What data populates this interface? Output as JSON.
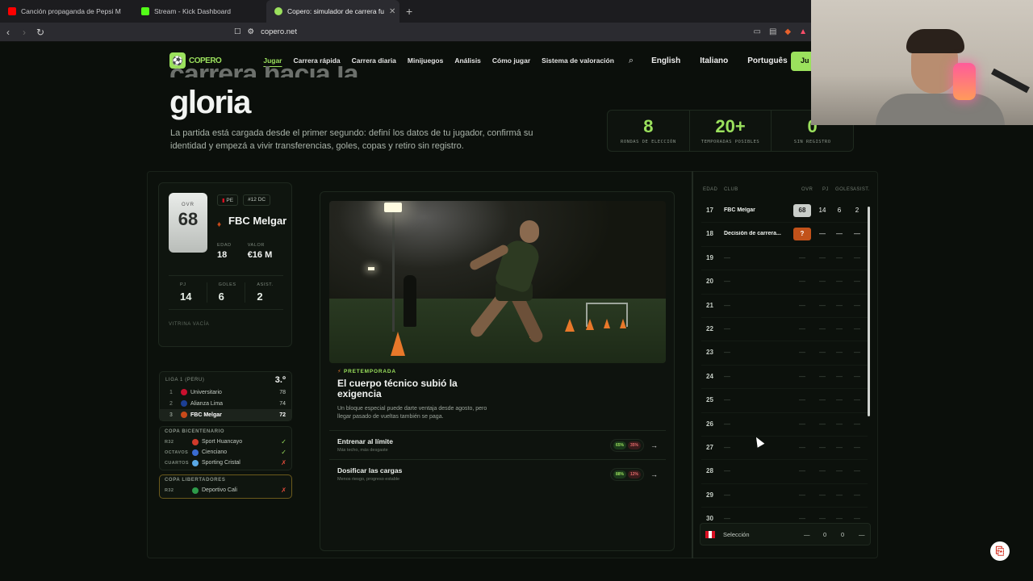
{
  "browser": {
    "tabs": [
      {
        "title": "Canción propaganda de Pepsi M",
        "color": "#ff0000"
      },
      {
        "title": "Stream - Kick Dashboard",
        "color": "#53fc18"
      },
      {
        "title": "Copero: simulador de carrera fu",
        "color": "#9be15d",
        "active": true
      }
    ],
    "url": "copero.net"
  },
  "header": {
    "logo_text": "COPERO",
    "menu": [
      "Jugar",
      "Carrera rápida",
      "Carrera diaria",
      "Minijuegos",
      "Análisis",
      "Cómo jugar",
      "Sistema de valoración"
    ],
    "langs": [
      "English",
      "Italiano",
      "Português"
    ],
    "cta": "Ju"
  },
  "hero": {
    "title_partial": "carrera hacia la",
    "title": "gloria",
    "subtitle": "La partida está cargada desde el primer segundo: definí los datos de tu jugador, confirmá su identidad y empezá a vivir transferencias, goles, copas y retiro sin registro.",
    "stats": [
      {
        "num": "8",
        "label": "RONDAS DE ELECCIÓN"
      },
      {
        "num": "20+",
        "label": "TEMPORADAS POSIBLES"
      },
      {
        "num": "0",
        "label": "SIN REGISTRO"
      }
    ]
  },
  "player": {
    "ovr_label": "OVR",
    "ovr": "68",
    "country": "PE",
    "number": "#12 DC",
    "club": "FBC Melgar",
    "age_label": "EDAD",
    "age": "18",
    "value_label": "VALOR",
    "value": "€16 M",
    "pj_label": "PJ",
    "pj": "14",
    "goals_label": "GOLES",
    "goals": "6",
    "assists_label": "ASIST.",
    "assists": "2",
    "trophies": "VITRINA VACÍA"
  },
  "league": {
    "name": "LIGA 1 (PERU)",
    "position": "3.º",
    "rows": [
      {
        "rank": "1",
        "team": "Universitario",
        "pts": "78",
        "color": "#c8102e"
      },
      {
        "rank": "2",
        "team": "Alianza Lima",
        "pts": "74",
        "color": "#1c3f94"
      },
      {
        "rank": "3",
        "team": "FBC Melgar",
        "pts": "72",
        "color": "#c84a1a",
        "highlight": true
      }
    ]
  },
  "cups": [
    {
      "title": "COPA BICENTENARIO",
      "rows": [
        {
          "round": "R32",
          "team": "Sport Huancayo",
          "result": "✓",
          "ok": true,
          "color": "#d13a2b"
        },
        {
          "round": "OCTAVOS",
          "team": "Cienciano",
          "result": "✓",
          "ok": true,
          "color": "#3a6bd1"
        },
        {
          "round": "CUARTOS",
          "team": "Sporting Cristal",
          "result": "✗",
          "ok": false,
          "color": "#5aa9e6"
        }
      ]
    },
    {
      "title": "COPA LIBERTADORES",
      "rows": [
        {
          "round": "R32",
          "team": "Deportivo Cali",
          "result": "✗",
          "ok": false,
          "color": "#2e9b4a"
        }
      ]
    }
  ],
  "event": {
    "tag": "PRETEMPORADA",
    "title": "El cuerpo técnico subió la exigencia",
    "desc": "Un bloque especial puede darte ventaja desde agosto, pero llegar pasado de vueltas también se paga.",
    "options": [
      {
        "title": "Entrenar al límite",
        "sub": "Más techo, más desgaste",
        "good": "65%",
        "bad": "35%"
      },
      {
        "title": "Dosificar las cargas",
        "sub": "Menos riesgo, progreso estable",
        "good": "88%",
        "bad": "12%"
      }
    ]
  },
  "career": {
    "headers": [
      "EDAD",
      "CLUB",
      "OVR",
      "PJ",
      "GOLES",
      "ASIST."
    ],
    "rows": [
      {
        "age": "17",
        "club": "FBC Melgar",
        "ovr": "68",
        "pj": "14",
        "goles": "6",
        "asist": "2",
        "kind": "silver"
      },
      {
        "age": "18",
        "club": "Decisión de carrera...",
        "ovr": "?",
        "pj": "—",
        "goles": "—",
        "asist": "—",
        "kind": "orange"
      },
      {
        "age": "19",
        "club": "—",
        "ovr": "—",
        "pj": "—",
        "goles": "—",
        "asist": "—"
      },
      {
        "age": "20",
        "club": "—",
        "ovr": "—",
        "pj": "—",
        "goles": "—",
        "asist": "—"
      },
      {
        "age": "21",
        "club": "—",
        "ovr": "—",
        "pj": "—",
        "goles": "—",
        "asist": "—"
      },
      {
        "age": "22",
        "club": "—",
        "ovr": "—",
        "pj": "—",
        "goles": "—",
        "asist": "—"
      },
      {
        "age": "23",
        "club": "—",
        "ovr": "—",
        "pj": "—",
        "goles": "—",
        "asist": "—"
      },
      {
        "age": "24",
        "club": "—",
        "ovr": "—",
        "pj": "—",
        "goles": "—",
        "asist": "—"
      },
      {
        "age": "25",
        "club": "—",
        "ovr": "—",
        "pj": "—",
        "goles": "—",
        "asist": "—"
      },
      {
        "age": "26",
        "club": "—",
        "ovr": "—",
        "pj": "—",
        "goles": "—",
        "asist": "—"
      },
      {
        "age": "27",
        "club": "—",
        "ovr": "—",
        "pj": "—",
        "goles": "—",
        "asist": "—"
      },
      {
        "age": "28",
        "club": "—",
        "ovr": "—",
        "pj": "—",
        "goles": "—",
        "asist": "—"
      },
      {
        "age": "29",
        "club": "—",
        "ovr": "—",
        "pj": "—",
        "goles": "—",
        "asist": "—"
      },
      {
        "age": "30",
        "club": "—",
        "ovr": "—",
        "pj": "—",
        "goles": "—",
        "asist": "—"
      }
    ],
    "seleccion": {
      "label": "Selección",
      "ovr": "—",
      "pj": "0",
      "goles": "0",
      "asist": "—"
    }
  },
  "colors": {
    "accent": "#9be15d",
    "bg": "#0b0f0b"
  }
}
